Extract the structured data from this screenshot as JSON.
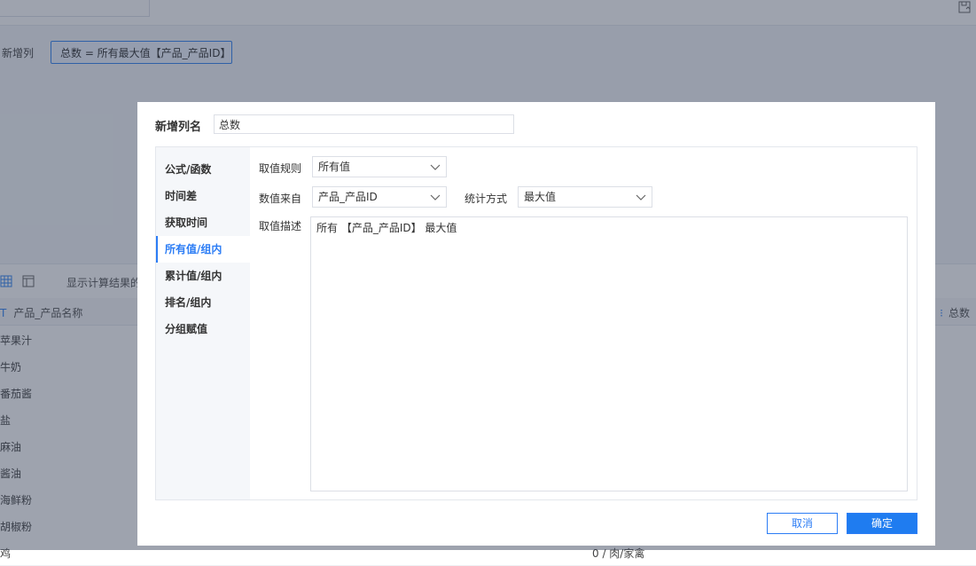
{
  "background": {
    "add_column_label": "新增列",
    "formula_chip": "总数 = 所有最大值【产品_产品ID】",
    "toolbar_text": "显示计算结果的",
    "col_header_1": "产品_产品名称",
    "col_header_2": "总数",
    "rows": [
      "苹果汁",
      "牛奶",
      "番茄酱",
      "盐",
      "麻油",
      "酱油",
      "海鲜粉",
      "胡椒粉",
      "鸡"
    ],
    "last_row_cell2": "0 / 肉/家禽"
  },
  "dialog": {
    "name_label": "新增列名",
    "name_value": "总数",
    "menu": [
      {
        "label": "公式/函数"
      },
      {
        "label": "时间差"
      },
      {
        "label": "获取时间"
      },
      {
        "label": "所有值/组内",
        "active": true
      },
      {
        "label": "累计值/组内"
      },
      {
        "label": "排名/组内"
      },
      {
        "label": "分组赋值"
      }
    ],
    "rule_label": "取值规则",
    "rule_value": "所有值",
    "source_label": "数值来自",
    "source_value": "产品_产品ID",
    "stat_label": "统计方式",
    "stat_value": "最大值",
    "desc_label": "取值描述",
    "desc_value": "所有 【产品_产品ID】 最大值",
    "cancel": "取消",
    "confirm": "确定"
  },
  "colors": {
    "accent": "#2c7df5",
    "overlay": "rgba(40,52,76,0.45)"
  },
  "icons": [
    "save-icon",
    "table-grid-icon",
    "panel-layout-icon",
    "chevron-down-icon"
  ]
}
